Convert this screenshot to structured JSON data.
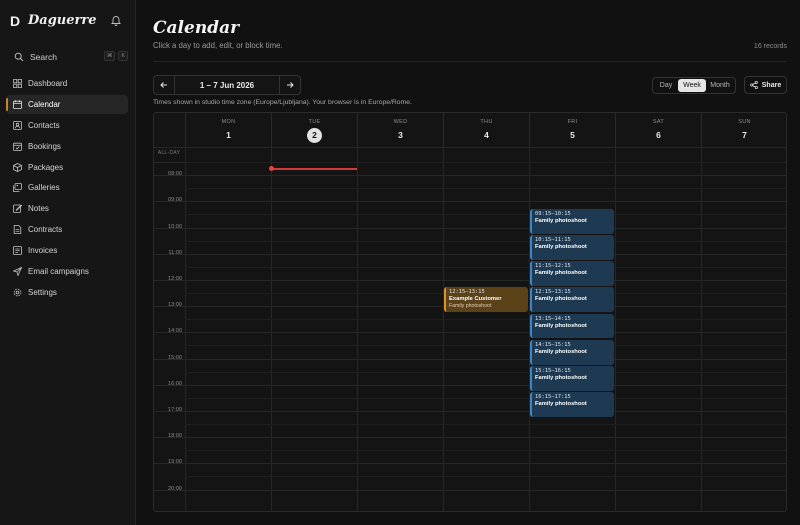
{
  "app": {
    "name": "Daguerre",
    "logo_letter": "D"
  },
  "sidebar": {
    "search": {
      "label": "Search",
      "shortcut": [
        "⌘",
        "K"
      ]
    },
    "items": [
      {
        "label": "Dashboard",
        "icon": "dashboard-icon",
        "active": false
      },
      {
        "label": "Calendar",
        "icon": "calendar-icon",
        "active": true
      },
      {
        "label": "Contacts",
        "icon": "contacts-icon",
        "active": false
      },
      {
        "label": "Bookings",
        "icon": "bookings-icon",
        "active": false
      },
      {
        "label": "Packages",
        "icon": "packages-icon",
        "active": false
      },
      {
        "label": "Galleries",
        "icon": "galleries-icon",
        "active": false
      },
      {
        "label": "Notes",
        "icon": "notes-icon",
        "active": false
      },
      {
        "label": "Contracts",
        "icon": "contracts-icon",
        "active": false
      },
      {
        "label": "Invoices",
        "icon": "invoices-icon",
        "active": false
      },
      {
        "label": "Email campaigns",
        "icon": "send-icon",
        "active": false
      },
      {
        "label": "Settings",
        "icon": "gear-icon",
        "active": false
      }
    ]
  },
  "header": {
    "title": "Calendar",
    "subtitle": "Click a day to add, edit, or block time.",
    "records": "16 records"
  },
  "toolbar": {
    "range_label": "1 – 7 Jun 2026",
    "views": [
      "Day",
      "Week",
      "Month"
    ],
    "active_view": "Week",
    "share_label": "Share"
  },
  "timezone_note": "Times shown in studio time zone (Europe/Ljubljana). Your browser is in Europe/Rome.",
  "calendar": {
    "allday_label": "ALL-DAY",
    "days": [
      {
        "name": "MON",
        "num": "1",
        "today": false
      },
      {
        "name": "TUE",
        "num": "2",
        "today": true
      },
      {
        "name": "WED",
        "num": "3",
        "today": false
      },
      {
        "name": "THU",
        "num": "4",
        "today": false
      },
      {
        "name": "FRI",
        "num": "5",
        "today": false
      },
      {
        "name": "SAT",
        "num": "6",
        "today": false
      },
      {
        "name": "SUN",
        "num": "7",
        "today": false
      }
    ],
    "hours": [
      "08:00",
      "09:00",
      "10:00",
      "11:00",
      "12:00",
      "13:00",
      "14:00",
      "15:00",
      "16:00",
      "17:00",
      "18:00",
      "19:00",
      "20:00"
    ],
    "start_hour": 7.5,
    "now": {
      "day_index": 1,
      "time": "07:45"
    },
    "events": [
      {
        "day_index": 3,
        "start": "12:15",
        "end": "13:15",
        "time": "12:15–13:15",
        "title": "Example Customer",
        "subtitle": "Family photoshoot",
        "color": "orange"
      },
      {
        "day_index": 4,
        "start": "09:15",
        "end": "10:15",
        "time": "09:15–10:15",
        "title": "Family photoshoot",
        "color": "blue"
      },
      {
        "day_index": 4,
        "start": "10:15",
        "end": "11:15",
        "time": "10:15–11:15",
        "title": "Family photoshoot",
        "color": "blue"
      },
      {
        "day_index": 4,
        "start": "11:15",
        "end": "12:15",
        "time": "11:15–12:15",
        "title": "Family photoshoot",
        "color": "blue"
      },
      {
        "day_index": 4,
        "start": "12:15",
        "end": "13:15",
        "time": "12:15–13:15",
        "title": "Family photoshoot",
        "color": "blue"
      },
      {
        "day_index": 4,
        "start": "13:15",
        "end": "14:15",
        "time": "13:15–14:15",
        "title": "Family photoshoot",
        "color": "blue"
      },
      {
        "day_index": 4,
        "start": "14:15",
        "end": "15:15",
        "time": "14:15–15:15",
        "title": "Family photoshoot",
        "color": "blue"
      },
      {
        "day_index": 4,
        "start": "15:15",
        "end": "16:15",
        "time": "15:15–16:15",
        "title": "Family photoshoot",
        "color": "blue"
      },
      {
        "day_index": 4,
        "start": "16:15",
        "end": "17:15",
        "time": "16:15–17:15",
        "title": "Family photoshoot",
        "color": "blue"
      }
    ]
  },
  "colors": {
    "accent": "#c8862a",
    "event_blue": "#3d86c6",
    "event_orange": "#d8922e",
    "now_line": "#d23b3b"
  }
}
